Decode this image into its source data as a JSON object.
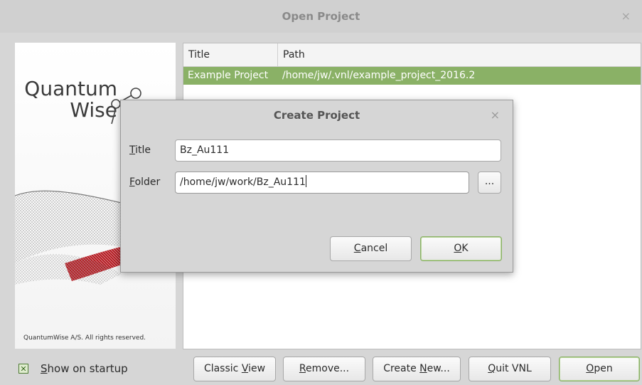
{
  "window": {
    "title": "Open Project",
    "close_glyph": "×"
  },
  "splash": {
    "logo_line1": "Quantum",
    "logo_line2": "Wise",
    "copyright": "QuantumWise A/S. All rights reserved."
  },
  "table": {
    "columns": [
      "Title",
      "Path"
    ],
    "rows": [
      {
        "title": "Example Project",
        "path": "/home/jw/.vnl/example_project_2016.2",
        "selected": true
      }
    ]
  },
  "footer": {
    "show_on_startup": {
      "checked": true,
      "pre": "",
      "key": "S",
      "post": "how on startup"
    },
    "buttons": {
      "classic_view": {
        "pre": "Classic ",
        "key": "V",
        "post": "iew"
      },
      "remove": {
        "pre": "",
        "key": "R",
        "post": "emove..."
      },
      "create_new": {
        "pre": "Create ",
        "key": "N",
        "post": "ew..."
      },
      "quit_vnl": {
        "pre": "",
        "key": "Q",
        "post": "uit VNL"
      },
      "open": {
        "pre": "",
        "key": "O",
        "post": "pen"
      }
    }
  },
  "dialog": {
    "title": "Create Project",
    "close_glyph": "×",
    "title_label": {
      "key": "T",
      "post": "itle"
    },
    "folder_label": {
      "key": "F",
      "post": "older"
    },
    "title_value": "Bz_Au111",
    "folder_value": "/home/jw/work/Bz_Au111",
    "browse_label": "...",
    "cancel": {
      "key": "C",
      "post": "ancel"
    },
    "ok": {
      "key": "O",
      "post": "K"
    }
  },
  "colors": {
    "accent": "#8ab166",
    "window_bg": "#d6d6d6"
  }
}
